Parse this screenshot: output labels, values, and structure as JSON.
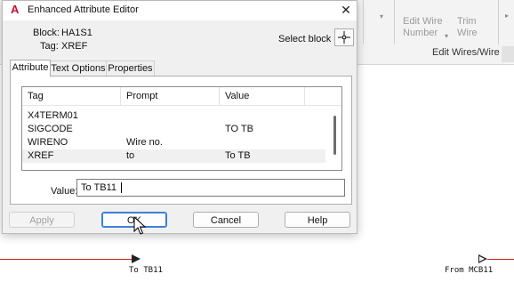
{
  "ribbon": {
    "btn_edit_wire_number": "Edit Wire\nNumber",
    "btn_trim_wire": "Trim\nWire",
    "panel_title": "Edit Wires/Wire Nu"
  },
  "drawing": {
    "left_wire_label": "To TB11",
    "right_wire_label": "From MCB11",
    "wire_color": "#d21e1e"
  },
  "dialog": {
    "title": "Enhanced Attribute Editor",
    "block_label": "Block:",
    "block_value": "HA1S1",
    "tag_label": "Tag:",
    "tag_value": "XREF",
    "select_block_label": "Select block",
    "tabs": [
      {
        "label": "Attribute",
        "active": true
      },
      {
        "label": "Text Options",
        "active": false
      },
      {
        "label": "Properties",
        "active": false
      }
    ],
    "columns": [
      "Tag",
      "Prompt",
      "Value"
    ],
    "rows": [
      {
        "tag": "X4TERM01",
        "prompt": "",
        "value": ""
      },
      {
        "tag": "SIGCODE",
        "prompt": "",
        "value": "TO TB"
      },
      {
        "tag": "WIRENO",
        "prompt": "Wire no.",
        "value": ""
      },
      {
        "tag": "XREF",
        "prompt": "to",
        "value": "To TB",
        "selected": true
      }
    ],
    "value_label": "Value:",
    "value_input": "To TB11",
    "buttons": {
      "apply": "Apply",
      "ok": "OK",
      "cancel": "Cancel",
      "help": "Help"
    },
    "accent_color": "#3d7fd8"
  }
}
